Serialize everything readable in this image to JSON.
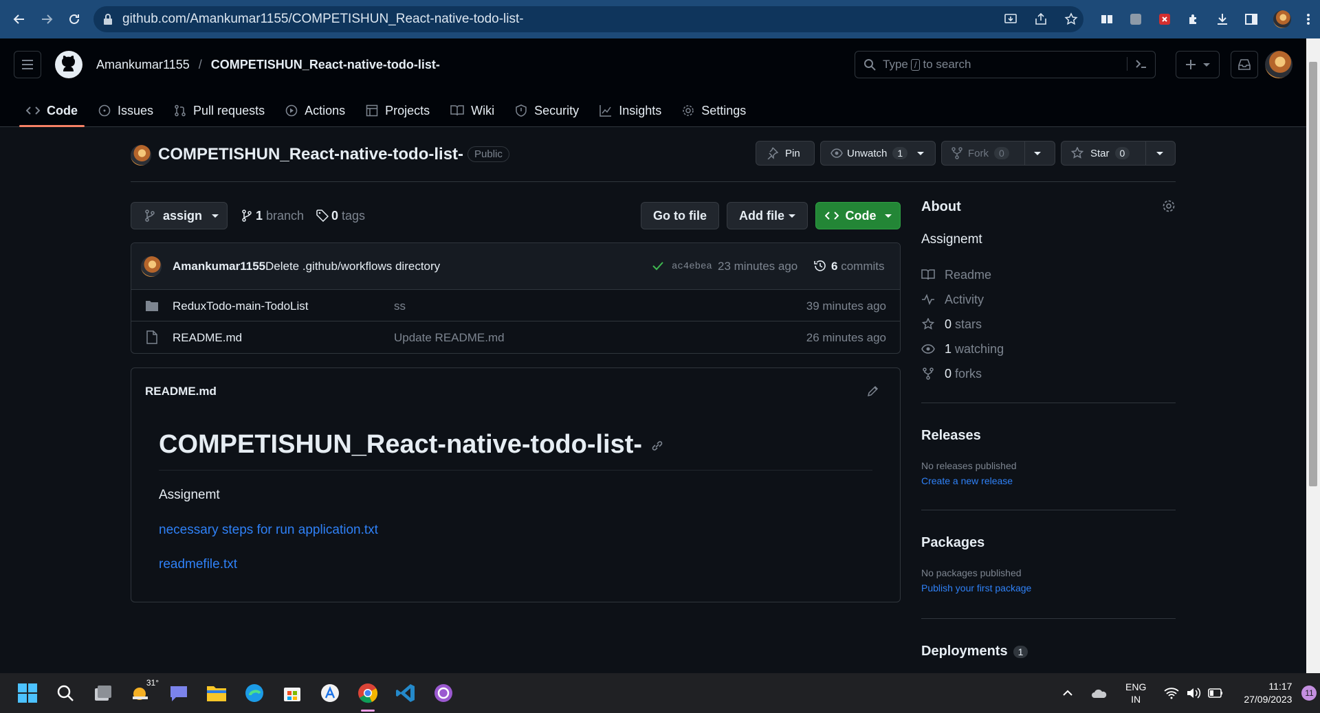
{
  "browser": {
    "url": "github.com/Amankumar1155/COMPETISHUN_React-native-todo-list-"
  },
  "header": {
    "owner": "Amankumar1155",
    "separator": "/",
    "repo": "COMPETISHUN_React-native-todo-list-",
    "search_placeholder_pre": "Type",
    "search_key": "/",
    "search_placeholder_post": "to search"
  },
  "tabs": [
    {
      "label": "Code",
      "icon": "code-icon"
    },
    {
      "label": "Issues",
      "icon": "issue-opened-icon"
    },
    {
      "label": "Pull requests",
      "icon": "git-pull-request-icon"
    },
    {
      "label": "Actions",
      "icon": "play-icon"
    },
    {
      "label": "Projects",
      "icon": "table-icon"
    },
    {
      "label": "Wiki",
      "icon": "book-icon"
    },
    {
      "label": "Security",
      "icon": "shield-icon"
    },
    {
      "label": "Insights",
      "icon": "graph-icon"
    },
    {
      "label": "Settings",
      "icon": "gear-icon"
    }
  ],
  "repo": {
    "name": "COMPETISHUN_React-native-todo-list-",
    "visibility": "Public",
    "pin": "Pin",
    "unwatch": "Unwatch",
    "watch_count": "1",
    "fork": "Fork",
    "fork_count": "0",
    "star": "Star",
    "star_count": "0"
  },
  "branch": {
    "name": "assign",
    "branch_count": "1",
    "branch_label": "branch",
    "tag_count": "0",
    "tag_label": "tags",
    "go_to_file": "Go to file",
    "add_file": "Add file",
    "code": "Code"
  },
  "commit": {
    "author": "Amankumar1155",
    "message": "Delete .github/workflows directory",
    "sha": "ac4ebea",
    "time": "23 minutes ago",
    "count": "6",
    "count_label": "commits"
  },
  "files": [
    {
      "name": "ReduxTodo-main-TodoList",
      "type": "folder",
      "message": "ss",
      "time": "39 minutes ago"
    },
    {
      "name": "README.md",
      "type": "file",
      "message": "Update README.md",
      "time": "26 minutes ago"
    }
  ],
  "readme": {
    "filename": "README.md",
    "title": "COMPETISHUN_React-native-todo-list-",
    "description": "Assignemt",
    "link1": "necessary steps for run application.txt",
    "link2": "readmefile.txt"
  },
  "about": {
    "title": "About",
    "description": "Assignemt",
    "readme": "Readme",
    "activity": "Activity",
    "stars_n": "0",
    "stars": "stars",
    "watching_n": "1",
    "watching": "watching",
    "forks_n": "0",
    "forks": "forks"
  },
  "releases": {
    "title": "Releases",
    "text": "No releases published",
    "link": "Create a new release"
  },
  "packages": {
    "title": "Packages",
    "text": "No packages published",
    "link": "Publish your first package"
  },
  "deployments": {
    "title": "Deployments",
    "count": "1"
  },
  "taskbar": {
    "weather": "31°",
    "lang": "ENG",
    "region": "IN",
    "time": "11:17",
    "date": "27/09/2023",
    "notif": "11"
  },
  "colors": {
    "accent": "#2f81f7",
    "code_green": "#238636",
    "tab_underline": "#f78166",
    "check": "#3fb950"
  }
}
